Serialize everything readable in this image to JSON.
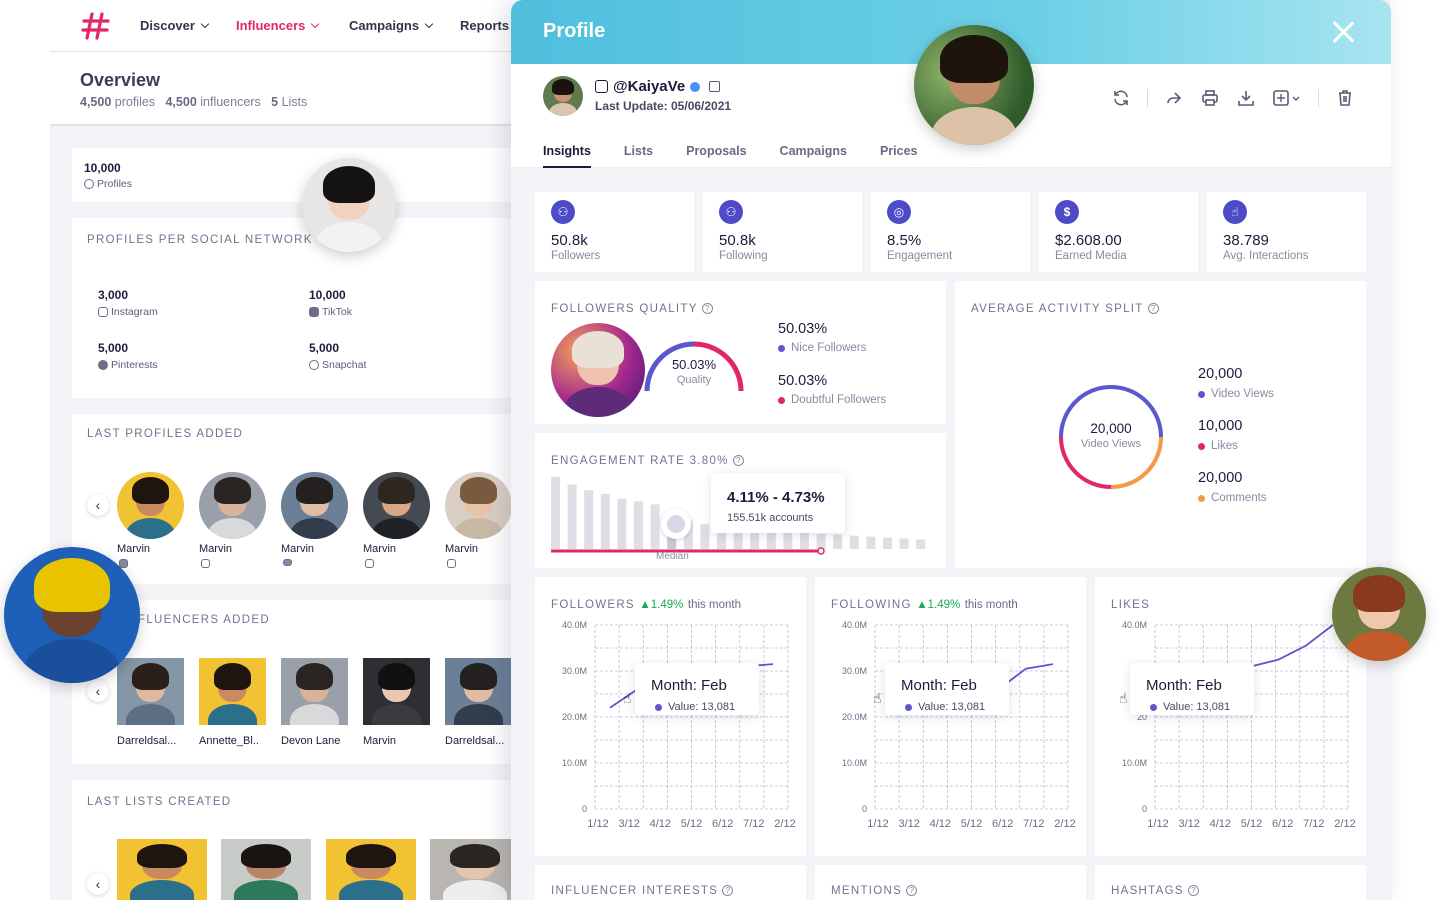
{
  "nav": {
    "items": [
      {
        "label": "Discover",
        "active": false
      },
      {
        "label": "Influencers",
        "active": true
      },
      {
        "label": "Campaigns",
        "active": false
      },
      {
        "label": "Reports",
        "active": false
      }
    ]
  },
  "overview": {
    "title": "Overview",
    "profiles_num": "4,500",
    "profiles_label": "profiles",
    "influencers_num": "4,500",
    "influencers_label": "influencers",
    "lists_num": "5",
    "lists_label": "Lists"
  },
  "profiles_card": {
    "value": "10,000",
    "label": "Profiles"
  },
  "social": {
    "title": "PROFILES PER SOCIAL NETWORK",
    "items": [
      {
        "value": "3,000",
        "label": "Instagram",
        "icon": "instagram-icon"
      },
      {
        "value": "10,000",
        "label": "TikTok",
        "icon": "tiktok-icon"
      },
      {
        "value": "5,000",
        "label": "Pinterests",
        "icon": "pinterest-icon"
      },
      {
        "value": "5,000",
        "label": "Snapchat",
        "icon": "snapchat-icon"
      }
    ]
  },
  "last_profiles": {
    "title": "LAST PROFILES ADDED",
    "names": [
      "Marvin",
      "Marvin",
      "Marvin",
      "Marvin",
      "Marvin"
    ]
  },
  "last_influencers": {
    "title": "FLUENCERS ADDED",
    "names": [
      "Darreldsal...",
      "Annette_Bl..",
      "Devon Lane",
      "Marvin",
      "Darreldsal..."
    ]
  },
  "last_lists": {
    "title": "LAST LISTS CREATED"
  },
  "panel": {
    "title": "Profile",
    "handle": "@KaiyaVe",
    "last_update": "Last Update: 05/06/2021",
    "tabs": [
      "Insights",
      "Lists",
      "Proposals",
      "Campaigns",
      "Prices"
    ],
    "active_tab": "Insights"
  },
  "kpis": [
    {
      "value": "50.8k",
      "label": "Followers",
      "icon": "followers-icon"
    },
    {
      "value": "50.8k",
      "label": "Following",
      "icon": "following-icon"
    },
    {
      "value": "8.5%",
      "label": "Engagement",
      "icon": "target-icon"
    },
    {
      "value": "$2.608.00",
      "label": "Earned Media",
      "icon": "dollar-icon"
    },
    {
      "value": "38.789",
      "label": "Avg. Interactions",
      "icon": "hand-icon"
    }
  ],
  "followers_quality": {
    "title": "FOLLOWERS QUALITY",
    "gauge_value": "50.03%",
    "gauge_label": "Quality",
    "nice_value": "50.03%",
    "nice_label": "Nice Followers",
    "doubtful_value": "50.03%",
    "doubtful_label": "Doubtful Followers",
    "quality_fraction": 0.5003
  },
  "activity_split": {
    "title": "AVERAGE ACTIVITY SPLIT",
    "center_value": "20,000",
    "center_label": "Video Views",
    "items": [
      {
        "value": "20,000",
        "label": "Video Views",
        "color": "#5a57cf"
      },
      {
        "value": "10,000",
        "label": "Likes",
        "color": "#e2266a"
      },
      {
        "value": "20,000",
        "label": "Comments",
        "color": "#f59a44"
      }
    ]
  },
  "engagement": {
    "title": "ENGAGEMENT RATE 3.80%",
    "tooltip_range": "4.11% - 4.73%",
    "tooltip_accounts": "155.51k accounts",
    "median_label": "Median"
  },
  "mini_charts": [
    {
      "title": "FOLLOWERS",
      "change": "1.49%",
      "suffix": "this month",
      "tooltip_month": "Month: Feb",
      "tooltip_value": "Value: 13,081"
    },
    {
      "title": "FOLLOWING",
      "change": "1.49%",
      "suffix": "this month",
      "tooltip_month": "Month: Feb",
      "tooltip_value": "Value: 13,081"
    },
    {
      "title": "LIKES",
      "change": "",
      "suffix": "",
      "tooltip_month": "Month: Feb",
      "tooltip_value": "Value: 13,081"
    }
  ],
  "bottom_cards": [
    "INFLUENCER INTERESTS",
    "MENTIONS",
    "HASHTAGS"
  ],
  "chart_data": [
    {
      "type": "bar",
      "title": "ENGAGEMENT RATE 3.80%",
      "values": [
        76,
        68,
        62,
        58,
        53,
        50,
        47,
        38,
        30,
        26,
        23,
        21,
        20,
        18,
        17,
        17,
        16,
        15,
        14,
        13,
        12,
        11,
        10
      ],
      "highlight_index": 7,
      "ylim": [
        0,
        80
      ]
    },
    {
      "type": "line",
      "title": "FOLLOWERS",
      "categories": [
        "1/12",
        "3/12",
        "4/12",
        "5/12",
        "6/12",
        "7/12",
        "2/12"
      ],
      "yticks": [
        "0",
        "10.0M",
        "20.0M",
        "30.0M",
        "40.0M"
      ],
      "ylim": [
        0,
        40
      ],
      "values": [
        22,
        26,
        28,
        30,
        30.5,
        31,
        31.5
      ]
    },
    {
      "type": "line",
      "title": "FOLLOWING",
      "categories": [
        "1/12",
        "3/12",
        "4/12",
        "5/12",
        "6/12",
        "7/12",
        "2/12"
      ],
      "yticks": [
        "0",
        "10.0M",
        "20.0M",
        "30.0M",
        "40.0M"
      ],
      "ylim": [
        0,
        40
      ],
      "values": [
        null,
        null,
        null,
        null,
        26,
        30.5,
        31.5
      ]
    },
    {
      "type": "line",
      "title": "LIKES",
      "categories": [
        "1/12",
        "3/12",
        "4/12",
        "5/12",
        "6/12",
        "7/12",
        "2/12"
      ],
      "yticks": [
        "0",
        "10.0M",
        "20",
        "30",
        "40.0M"
      ],
      "ylim": [
        0,
        40
      ],
      "values": [
        null,
        null,
        29,
        31,
        32.5,
        35.5,
        40
      ]
    }
  ]
}
